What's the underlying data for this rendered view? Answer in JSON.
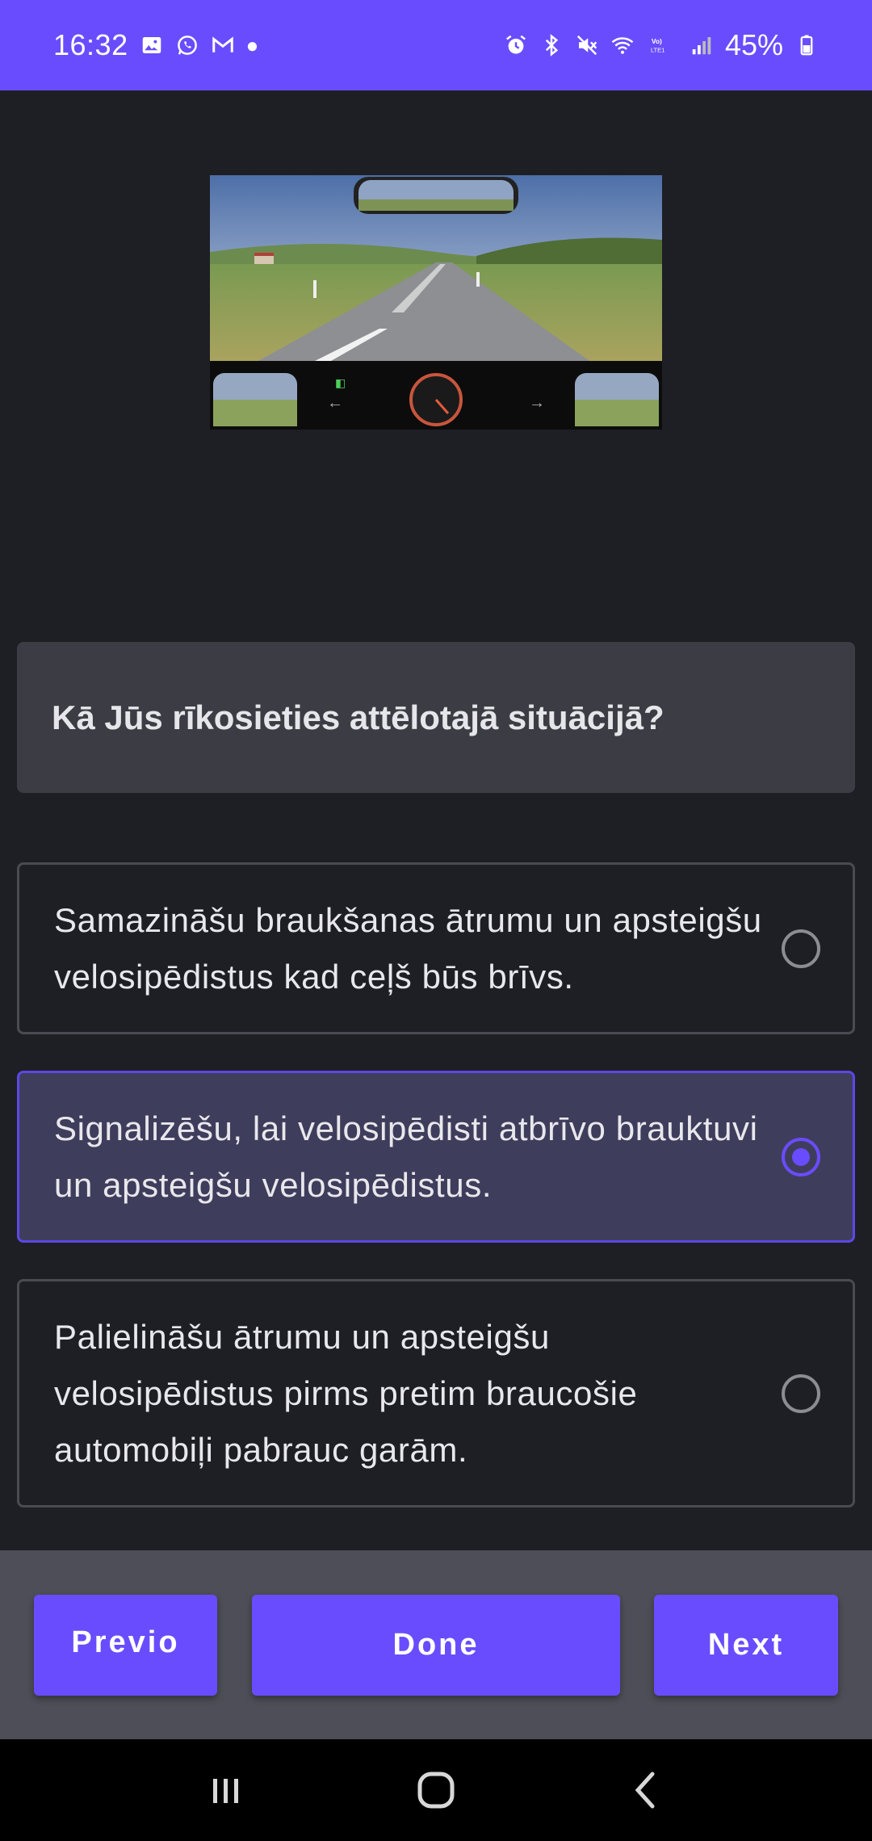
{
  "status_bar": {
    "time": "16:32",
    "battery": "45%",
    "left_icons": [
      "gallery-icon",
      "whatsapp-icon",
      "gmail-icon",
      "dot-icon"
    ],
    "right_icons": [
      "alarm-icon",
      "bluetooth-icon",
      "mute-icon",
      "wifi-icon",
      "volte-icon",
      "signal-icon",
      "battery-icon"
    ],
    "volte_label": "VoLTE1",
    "color": "#6a4cff"
  },
  "scene": {
    "icon": "driving-scene-image"
  },
  "question": {
    "text": "Kā Jūs rīkosieties attēlotajā situācijā?"
  },
  "options": [
    {
      "text": "Samazināšu braukšanas ātrumu un apsteigšu velosipēdistus kad ceļš būs brīvs.",
      "selected": false
    },
    {
      "text": "Signalizēšu, lai velosipēdisti atbrīvo brauktuvi un apsteigšu velosipēdistus.",
      "selected": true
    },
    {
      "text": "Palielināšu ātrumu un apsteigšu velosipēdistus pirms pretim braucošie automobiļi pabrauc garām.",
      "selected": false
    }
  ],
  "buttons": {
    "previous": "Previo",
    "done": "Done",
    "next": "Next"
  },
  "navbar": {
    "icons": [
      "recent-apps-icon",
      "home-icon",
      "back-icon"
    ]
  },
  "colors": {
    "accent": "#6a4cff",
    "background": "#1e1f24",
    "selected_background": "#3f3d5c"
  }
}
